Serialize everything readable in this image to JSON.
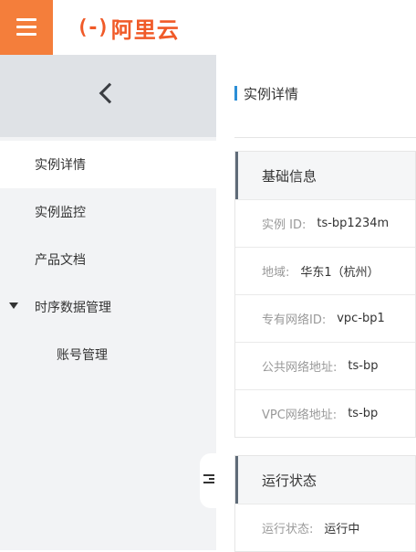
{
  "header": {
    "logo_mark": "(-)",
    "logo_text": "阿里云"
  },
  "sidebar": {
    "items": [
      {
        "label": "实例详情",
        "active": true
      },
      {
        "label": "实例监控"
      },
      {
        "label": "产品文档"
      },
      {
        "label": "时序数据管理",
        "expanded": true
      },
      {
        "label": "账号管理",
        "sub": true
      }
    ]
  },
  "main": {
    "page_title": "实例详情",
    "basic_info": {
      "title": "基础信息",
      "rows": [
        {
          "key": "实例 ID:",
          "value": "ts-bp1234m"
        },
        {
          "key": "地域:",
          "value": "华东1（杭州）"
        },
        {
          "key": "专有网络ID:",
          "value": "vpc-bp1"
        },
        {
          "key": "公共网络地址:",
          "value": "ts-bp"
        },
        {
          "key": "VPC网络地址:",
          "value": "ts-bp"
        }
      ]
    },
    "run_status": {
      "title": "运行状态",
      "rows": [
        {
          "key": "运行状态:",
          "value": "运行中"
        }
      ]
    }
  },
  "colors": {
    "brand": "#f47e3b",
    "accent": "#2b8ed6"
  }
}
